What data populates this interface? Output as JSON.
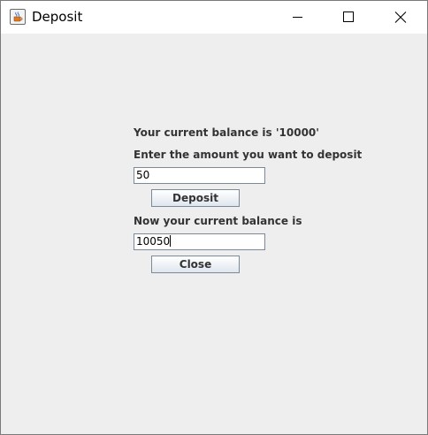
{
  "window": {
    "title": "Deposit",
    "icon": "java-cup-icon",
    "controls": [
      "minimize-icon",
      "maximize-icon",
      "close-icon"
    ]
  },
  "form": {
    "balance_label": "Your current balance is '10000'",
    "amount_label": "Enter the amount you want to deposit",
    "amount_value": "50",
    "deposit_button_label": "Deposit",
    "new_balance_label": "Now your current balance is",
    "new_balance_value": "10050",
    "close_button_label": "Close"
  }
}
